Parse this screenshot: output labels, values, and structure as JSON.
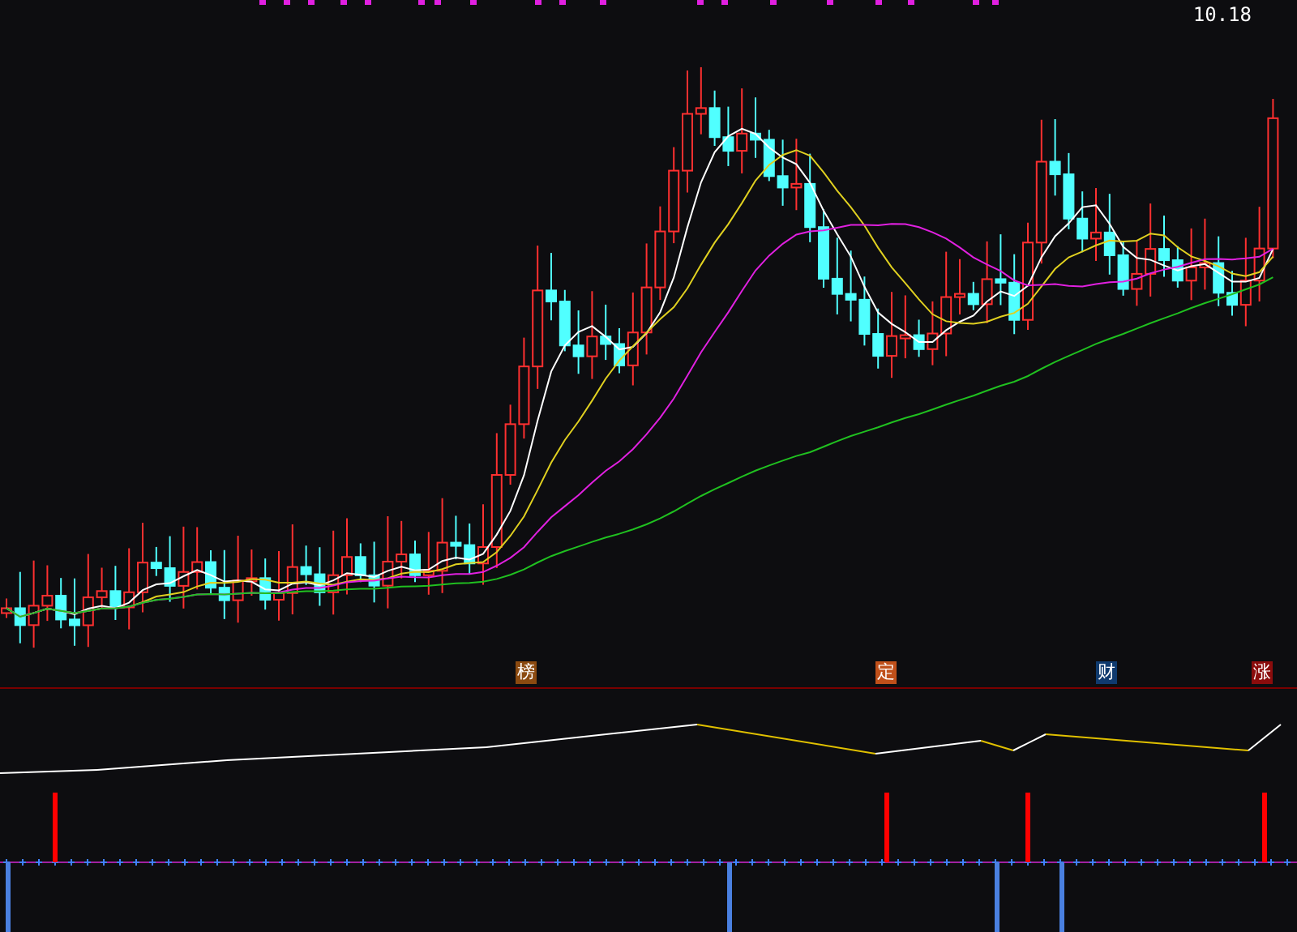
{
  "price_chart": {
    "high_label": "10.18"
  },
  "markers": [
    {
      "label": "榜",
      "color": "#8b4a10"
    },
    {
      "label": "定",
      "color": "#c0501a"
    },
    {
      "label": "财",
      "color": "#0f3a6e"
    },
    {
      "label": "涨",
      "color": "#8b0c0c"
    }
  ]
}
